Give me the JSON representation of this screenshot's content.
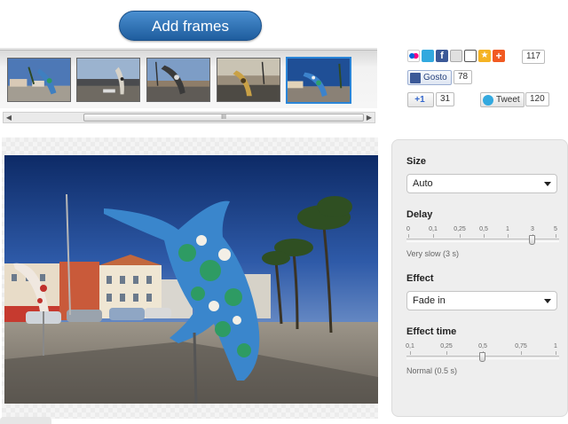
{
  "toolbar": {
    "add_frames_label": "Add frames"
  },
  "filmstrip": {
    "frames": [
      "frame-1",
      "frame-2",
      "frame-3",
      "frame-4",
      "frame-5"
    ],
    "selected_index": 4,
    "scroll_grip": "III"
  },
  "social": {
    "share_count": "117",
    "facebook_like_label": "Gosto",
    "facebook_like_count": "78",
    "gplus_label": "+1",
    "gplus_count": "31",
    "tweet_label": "Tweet",
    "tweet_count": "120",
    "icons": [
      "flickr-icon",
      "twitter-icon",
      "facebook-icon",
      "email-icon",
      "print-icon",
      "favorite-icon",
      "add-icon"
    ]
  },
  "settings": {
    "size_label": "Size",
    "size_value": "Auto",
    "delay_label": "Delay",
    "delay_ticks": [
      "0",
      "0,1",
      "0,25",
      "0,5",
      "1",
      "3",
      "5"
    ],
    "delay_note": "Very slow (3 s)",
    "effect_label": "Effect",
    "effect_value": "Fade in",
    "effect_time_label": "Effect time",
    "effect_time_ticks": [
      "0,1",
      "0,25",
      "0,5",
      "0,75",
      "1"
    ],
    "effect_time_note": "Normal (0.5 s)"
  },
  "colors": {
    "accent": "#2a85d8",
    "button": "#2e73b8",
    "panel": "#eeeeee"
  }
}
